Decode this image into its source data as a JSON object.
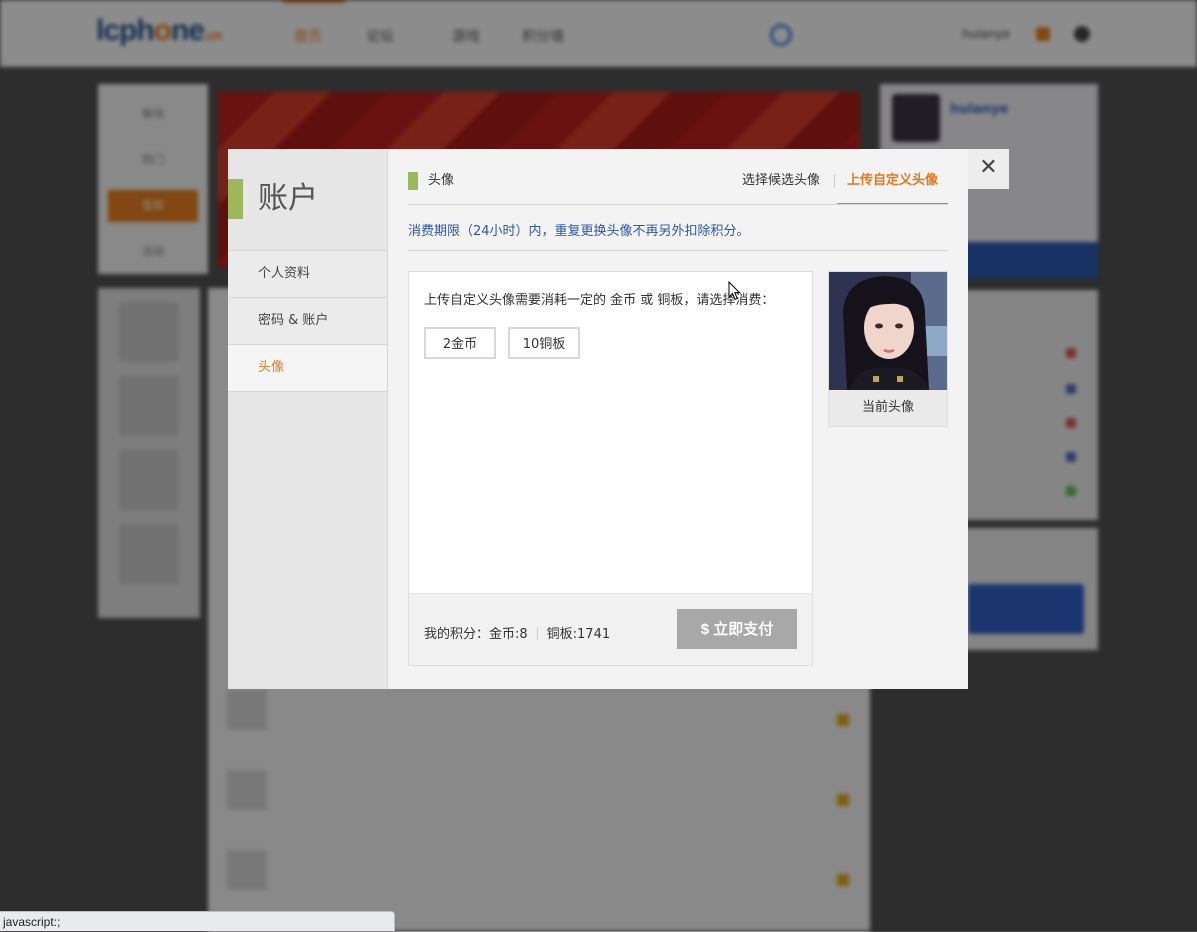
{
  "background": {
    "logo": {
      "main_a": "lcph",
      "main_o": "o",
      "main_b": "ne",
      "suffix": ".cn"
    },
    "nav": [
      "首页",
      "论坛",
      "游戏",
      "积分墙"
    ],
    "user": "hulanye",
    "left_items": [
      "板块",
      "热门",
      "签到",
      "活动"
    ]
  },
  "modal": {
    "side_title": "账户",
    "menu": [
      {
        "label": "个人资料",
        "active": false
      },
      {
        "label": "密码 & 账户",
        "active": false
      },
      {
        "label": "头像",
        "active": true
      }
    ],
    "close_glyph": "✕",
    "header_title": "头像",
    "tabs": [
      {
        "label": "选择候选头像",
        "active": false
      },
      {
        "label": "上传自定义头像",
        "active": true
      }
    ],
    "notice": "消费期限（24小时）内，重复更换头像不再另外扣除积分。",
    "instruction": "上传自定义头像需要消耗一定的 金币 或 铜板，请选择消费：",
    "options": [
      "2金币",
      "10铜板"
    ],
    "score_prefix": "我的积分：金币:8",
    "score_copper": "铜板:1741",
    "pay_button": "$ 立即支付",
    "avatar_caption": "当前头像"
  },
  "status_bar": "javascript:;",
  "colors": {
    "accent": "#e07a1f",
    "green": "#9cb85a",
    "notice_blue": "#2a57a8",
    "pay_grey": "#a8a8a8"
  }
}
